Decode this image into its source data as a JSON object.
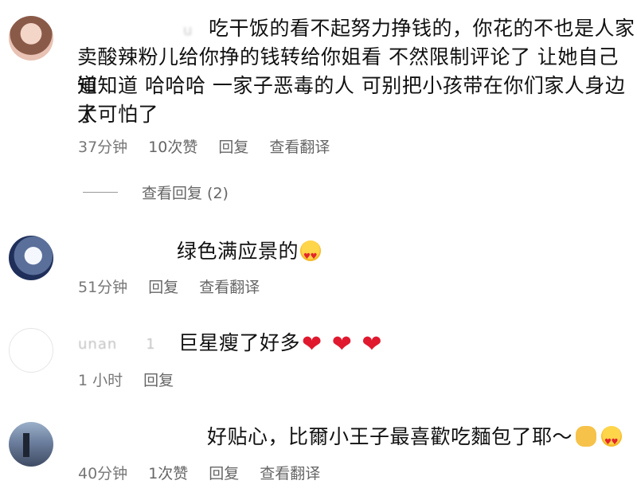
{
  "comments": [
    {
      "name": "u",
      "text_lines": [
        "吃干饭的看不起努力挣钱的，你花的不也是人家",
        "卖酸辣粉儿给你挣的钱转给你姐看 不然限制评论了 让她自己知",
        "道知道 哈哈哈 一家子恶毒的人 可别把小孩带在你们家人身边了",
        "太可怕了"
      ],
      "time": "37分钟",
      "likes": "10次赞",
      "reply": "回复",
      "translate": "查看翻译",
      "view_replies": "查看回复 (2)"
    },
    {
      "name": "",
      "text": "绿色满应景的",
      "emoji": "heart-eyes-emoji",
      "time": "51分钟",
      "reply": "回复",
      "translate": "查看翻译"
    },
    {
      "name": "unan",
      "name_suffix": "1",
      "text": "巨星瘦了好多",
      "emoji": "red-heart-emoji",
      "time": "1 小时",
      "reply": "回复"
    },
    {
      "name": "",
      "text": "好贴心，比爾小王子最喜歡吃麵包了耶～",
      "emoji": "clapping-and-heart-eyes-emoji",
      "time": "40分钟",
      "likes": "1次赞",
      "reply": "回复",
      "translate": "查看翻译"
    }
  ],
  "colors": {
    "text": "#111111",
    "meta": "#666666",
    "heart": "#e0192f",
    "background": "#ffffff"
  }
}
